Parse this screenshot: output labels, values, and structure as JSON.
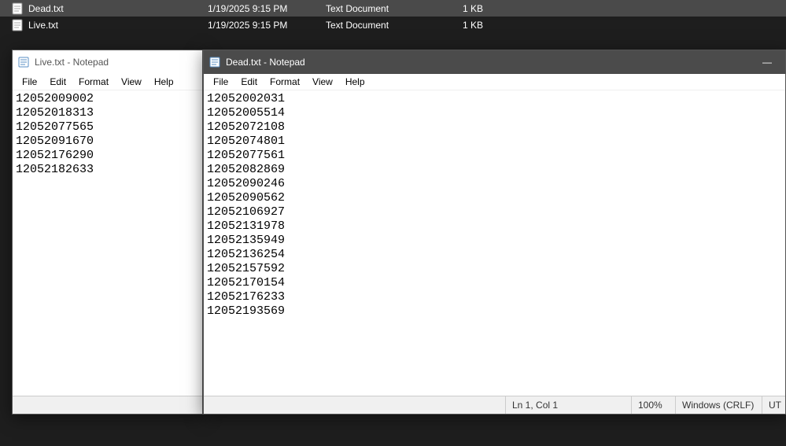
{
  "explorer": {
    "files": [
      {
        "name": "Dead.txt",
        "date": "1/19/2025 9:15 PM",
        "type": "Text Document",
        "size": "1 KB",
        "selected": true
      },
      {
        "name": "Live.txt",
        "date": "1/19/2025 9:15 PM",
        "type": "Text Document",
        "size": "1 KB",
        "selected": false
      }
    ]
  },
  "notepad_live": {
    "title": "Live.txt - Notepad",
    "menu": {
      "file": "File",
      "edit": "Edit",
      "format": "Format",
      "view": "View",
      "help": "Help"
    },
    "content": [
      "12052009002",
      "12052018313",
      "12052077565",
      "12052091670",
      "12052176290",
      "12052182633"
    ]
  },
  "notepad_dead": {
    "title": "Dead.txt - Notepad",
    "menu": {
      "file": "File",
      "edit": "Edit",
      "format": "Format",
      "view": "View",
      "help": "Help"
    },
    "content": [
      "12052002031",
      "12052005514",
      "12052072108",
      "12052074801",
      "12052077561",
      "12052082869",
      "12052090246",
      "12052090562",
      "12052106927",
      "12052131978",
      "12052135949",
      "12052136254",
      "12052157592",
      "12052170154",
      "12052176233",
      "12052193569"
    ],
    "status": {
      "pos": "Ln 1, Col 1",
      "zoom": "100%",
      "eol": "Windows (CRLF)",
      "enc": "UT"
    },
    "controls": {
      "min": "—"
    }
  }
}
